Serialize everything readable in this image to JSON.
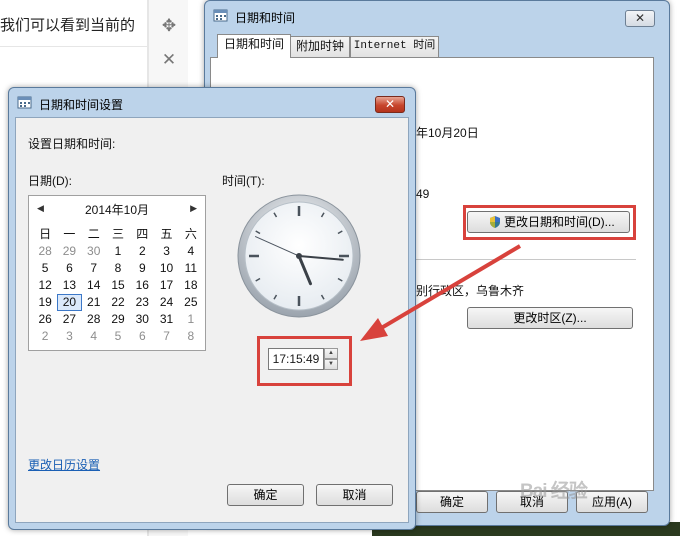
{
  "document": {
    "visible_text": "我们可以看到当前的"
  },
  "main_window": {
    "title": "日期和时间",
    "close_label": "✕",
    "tabs": [
      {
        "label": "日期和时间"
      },
      {
        "label": "附加时钟"
      },
      {
        "label": "Internet 时间"
      }
    ],
    "date_fragment": "年10月20日",
    "time_fragment": "49",
    "change_datetime_button": "更改日期和时间(D)...",
    "timezone_fragment": "别行政区，乌鲁木齐",
    "change_timezone_button": "更改时区(Z)...",
    "ok_button": "确定",
    "cancel_button": "取消",
    "apply_button": "应用(A)"
  },
  "settings_dialog": {
    "title": "日期和时间设置",
    "close_label": "✕",
    "heading": "设置日期和时间:",
    "date_label": "日期(D):",
    "time_label": "时间(T):",
    "calendar": {
      "month_title": "2014年10月",
      "prev_arrow": "◀",
      "next_arrow": "▶",
      "weekdays": [
        "日",
        "一",
        "二",
        "三",
        "四",
        "五",
        "六"
      ],
      "days": [
        [
          "28",
          "29",
          "30",
          "1",
          "2",
          "3",
          "4"
        ],
        [
          "5",
          "6",
          "7",
          "8",
          "9",
          "10",
          "11"
        ],
        [
          "12",
          "13",
          "14",
          "15",
          "16",
          "17",
          "18"
        ],
        [
          "19",
          "20",
          "21",
          "22",
          "23",
          "24",
          "25"
        ],
        [
          "26",
          "27",
          "28",
          "29",
          "30",
          "31",
          "1"
        ],
        [
          "2",
          "3",
          "4",
          "5",
          "6",
          "7",
          "8"
        ]
      ],
      "selected_day": "20"
    },
    "clock": {
      "hour": 17,
      "minute": 15,
      "second": 49
    },
    "time_value": "17:15:49",
    "change_calendar_link": "更改日历设置",
    "ok_button": "确定",
    "cancel_button": "取消"
  },
  "watermark": "Bai 经验",
  "colors": {
    "annotation_red": "#d8423c",
    "title_bar_blue": "#bcd3ea",
    "link_blue": "#1a5fb4"
  }
}
